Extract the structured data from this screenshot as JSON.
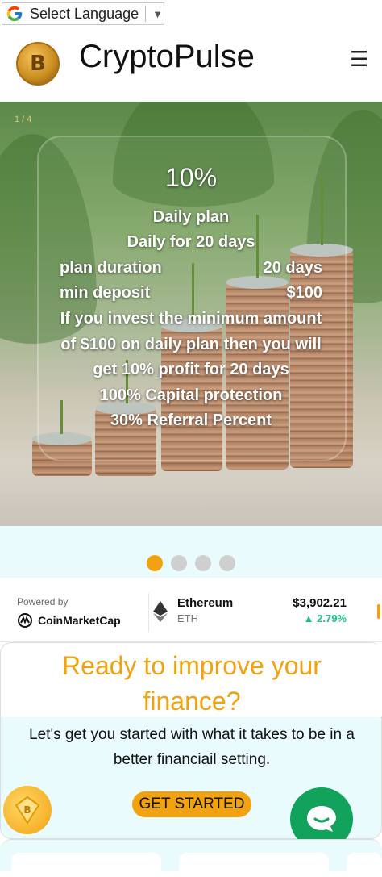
{
  "translate": {
    "label": "Select Language",
    "caret": "▼"
  },
  "header": {
    "brand": "CryptoPulse",
    "menu_icon": "☰",
    "logo_letter": "B"
  },
  "hero": {
    "slide_counter": "1 / 4",
    "percent": "10%",
    "plan_name": "Daily plan",
    "plan_period": "Daily for 20 days",
    "rows": [
      {
        "label": "plan duration",
        "value": "20 days"
      },
      {
        "label": "min deposit",
        "value": "$100"
      }
    ],
    "desc_1": "If you invest the minimum amount",
    "desc_2": "of $100 on daily plan then you will",
    "desc_3": "get 10% profit for 20 days",
    "feature_1": "100% Capital protection",
    "feature_2": "30% Referral Percent"
  },
  "carousel": {
    "total_dots": 4,
    "active_dot": 1
  },
  "ticker": {
    "powered_by": "Powered by",
    "provider": "CoinMarketCap",
    "coin_name": "Ethereum",
    "coin_symbol": "ETH",
    "price": "$3,902.21",
    "change": "▲ 2.79%",
    "change_color": "#16c784"
  },
  "cta": {
    "title_1": "Ready to improve your",
    "title_2": "finance?",
    "body_1": "Let's get you started with what it takes to be in a",
    "body_2": "better financiail setting.",
    "button": "GET STARTED"
  },
  "colors": {
    "accent": "#f2a20f",
    "chat": "#11a35c",
    "panel": "#eafbfd"
  }
}
